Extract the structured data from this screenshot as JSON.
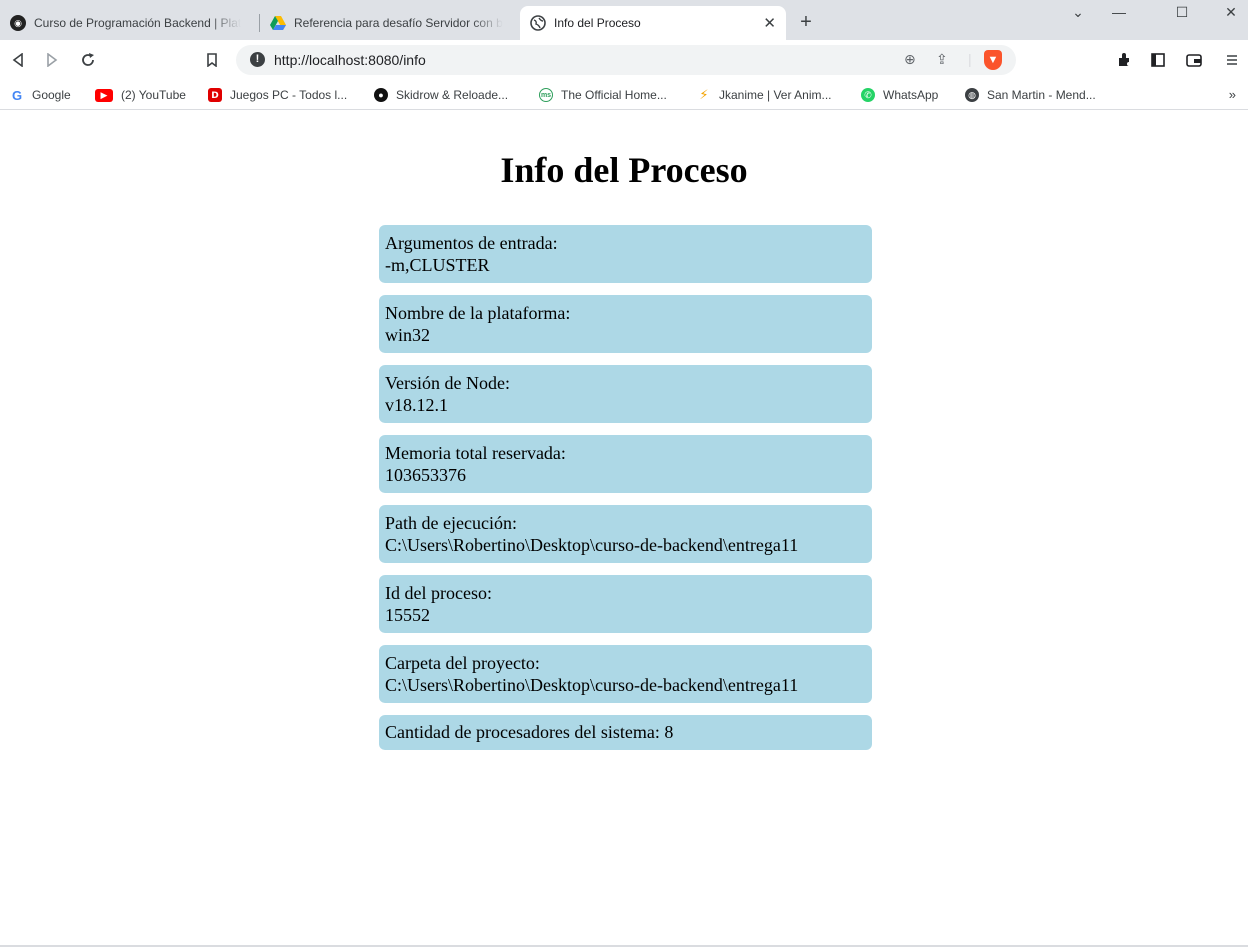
{
  "browser": {
    "tabs": [
      {
        "title": "Curso de Programación Backend | Plat",
        "active": false
      },
      {
        "title": "Referencia para desafío Servidor con b",
        "active": false
      },
      {
        "title": "Info del Proceso",
        "active": true
      }
    ],
    "new_tab": "+",
    "window_controls": {
      "dropdown": "⌄",
      "minimize": "—",
      "maximize": "☐",
      "close": "✕"
    },
    "url": "http://localhost:8080/info",
    "bookmarks": [
      {
        "label": "Google",
        "icon": "google-icon",
        "color": "#4285f4"
      },
      {
        "label": "(2) YouTube",
        "icon": "youtube-icon",
        "color": "#ff0000"
      },
      {
        "label": "Juegos PC - Todos l...",
        "icon": "juegos-icon",
        "color": "#e00000"
      },
      {
        "label": "Skidrow & Reloade...",
        "icon": "skidrow-icon",
        "color": "#111111"
      },
      {
        "label": "The Official Home...",
        "icon": "official-home-icon",
        "color": "#2e9e5b"
      },
      {
        "label": "Jkanime | Ver Anim...",
        "icon": "jkanime-icon",
        "color": "#f4a300"
      },
      {
        "label": "WhatsApp",
        "icon": "whatsapp-icon",
        "color": "#25d366"
      },
      {
        "label": "San Martin - Mend...",
        "icon": "globe-icon",
        "color": "#3c4043"
      }
    ],
    "bookmarks_more": "»"
  },
  "page": {
    "heading": "Info del Proceso",
    "cards": [
      {
        "label": "Argumentos de entrada:",
        "value": "-m,CLUSTER"
      },
      {
        "label": "Nombre de la plataforma:",
        "value": "win32"
      },
      {
        "label": "Versión de Node:",
        "value": "v18.12.1"
      },
      {
        "label": "Memoria total reservada:",
        "value": "103653376"
      },
      {
        "label": "Path de ejecución:",
        "value": "C:\\Users\\Robertino\\Desktop\\curso-de-backend\\entrega11"
      },
      {
        "label": "Id del proceso:",
        "value": "15552"
      },
      {
        "label": "Carpeta del proyecto:",
        "value": "C:\\Users\\Robertino\\Desktop\\curso-de-backend\\entrega11"
      },
      {
        "label": "Cantidad de procesadores del sistema: 8"
      }
    ],
    "card_color": "#add8e6"
  }
}
